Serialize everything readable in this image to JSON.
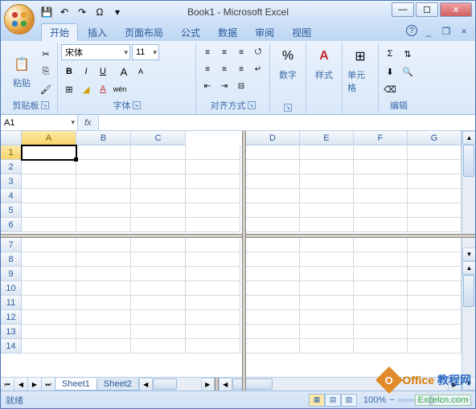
{
  "window": {
    "title": "Book1 - Microsoft Excel"
  },
  "qat": {
    "save": "💾",
    "undo": "↶",
    "redo": "↷",
    "omega": "Ω"
  },
  "tabs": {
    "items": [
      "开始",
      "插入",
      "页面布局",
      "公式",
      "数据",
      "审阅",
      "视图"
    ],
    "active_index": 0,
    "help": "?",
    "minimize": "_",
    "close": "×"
  },
  "ribbon": {
    "clipboard": {
      "label": "剪贴板",
      "paste": "粘贴"
    },
    "font": {
      "label": "字体",
      "name": "宋体",
      "size": "11",
      "bold": "B",
      "italic": "I",
      "underline": "U",
      "grow": "A",
      "shrink": "A",
      "wen": "wén"
    },
    "alignment": {
      "label": "对齐方式"
    },
    "number": {
      "label": "数字",
      "btn": "%"
    },
    "styles": {
      "label": "样式",
      "btn": "A"
    },
    "cells": {
      "label": "单元格"
    },
    "editing": {
      "label": "编辑",
      "sigma": "Σ"
    }
  },
  "namebox": {
    "value": "A1",
    "fx": "fx"
  },
  "grid": {
    "cols_left": [
      "A",
      "B",
      "C"
    ],
    "cols_right": [
      "D",
      "E",
      "F",
      "G"
    ],
    "rows_top": [
      "1",
      "2",
      "3",
      "4",
      "5",
      "6"
    ],
    "rows_bottom": [
      "7",
      "8",
      "9",
      "10",
      "11",
      "12",
      "13",
      "14"
    ],
    "selected": "A1"
  },
  "sheets": {
    "items": [
      "Sheet1",
      "Sheet2"
    ],
    "active_index": 0
  },
  "status": {
    "ready": "就绪",
    "zoom": "100%"
  },
  "watermark": {
    "line1a": "Office",
    "line1b": "教程网",
    "line2": "Excelcn.com"
  }
}
